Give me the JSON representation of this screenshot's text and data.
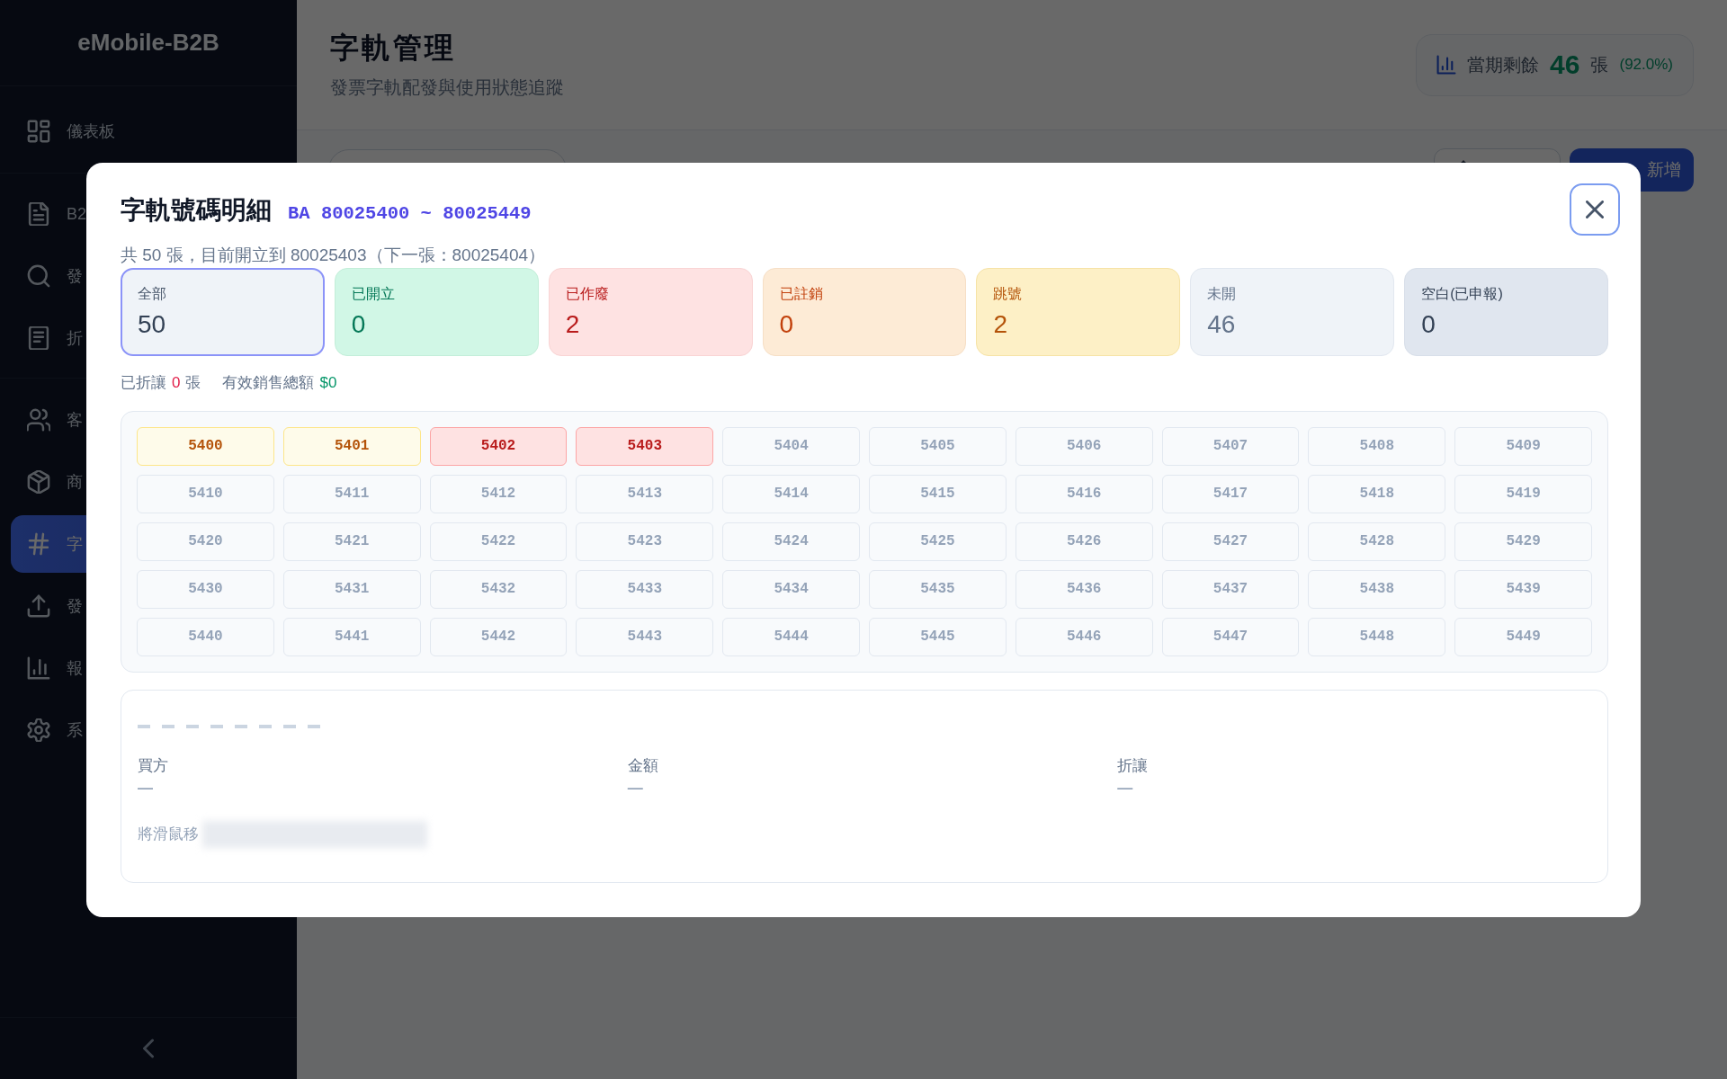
{
  "sidebar": {
    "brand": "eMobile-B2B",
    "sections": [
      {
        "items": [
          {
            "label": "儀表板",
            "selected": false
          }
        ]
      },
      {
        "items": [
          {
            "label": "B2",
            "selected": false
          },
          {
            "label": "發",
            "selected": false
          },
          {
            "label": "折",
            "selected": false
          }
        ]
      },
      {
        "items": [
          {
            "label": "客",
            "selected": false
          },
          {
            "label": "商",
            "selected": false
          },
          {
            "label": "字",
            "selected": true
          },
          {
            "label": "發",
            "selected": false
          },
          {
            "label": "報",
            "selected": false
          },
          {
            "label": "系",
            "selected": false
          }
        ]
      }
    ]
  },
  "page_header": {
    "title": "字軌管理",
    "subtitle": "發票字軌配發與使用狀態追蹤",
    "remaining": {
      "label": "當期剩餘",
      "count": "46",
      "unit": "張",
      "percent": "(92.0%)"
    }
  },
  "toolbar": {
    "add_button": "新增"
  },
  "modal": {
    "title": "字軌號碼明細",
    "range": "BA 80025400 ~ 80025449",
    "close_button": {
      "focused": true
    },
    "summary": "共 50 張，目前開立到 80025403（下一張：80025404）",
    "stats": [
      {
        "label": "全部",
        "value": "50",
        "kind": "all",
        "selected": true
      },
      {
        "label": "已開立",
        "value": "0",
        "kind": "issued",
        "selected": false
      },
      {
        "label": "已作廢",
        "value": "2",
        "kind": "void",
        "selected": false
      },
      {
        "label": "已註銷",
        "value": "0",
        "kind": "cancelled",
        "selected": false
      },
      {
        "label": "跳號",
        "value": "2",
        "kind": "skipped",
        "selected": false
      },
      {
        "label": "未開",
        "value": "46",
        "kind": "unused",
        "selected": false
      },
      {
        "label": "空白(已申報)",
        "value": "0",
        "kind": "blank",
        "selected": false
      }
    ],
    "totals": [
      {
        "label": "已折讓",
        "value": "0",
        "unit": "張",
        "color": "#e11d48"
      },
      {
        "label": "有效銷售總額",
        "value": "$0",
        "color": "#059669"
      }
    ],
    "numbers": [
      {
        "number": "5400",
        "kind": "skipped"
      },
      {
        "number": "5401",
        "kind": "skipped"
      },
      {
        "number": "5402",
        "kind": "void"
      },
      {
        "number": "5403",
        "kind": "void"
      },
      {
        "number": "5404",
        "kind": "unused"
      },
      {
        "number": "5405",
        "kind": "unused"
      },
      {
        "number": "5406",
        "kind": "unused"
      },
      {
        "number": "5407",
        "kind": "unused"
      },
      {
        "number": "5408",
        "kind": "unused"
      },
      {
        "number": "5409",
        "kind": "unused"
      },
      {
        "number": "5410",
        "kind": "unused"
      },
      {
        "number": "5411",
        "kind": "unused"
      },
      {
        "number": "5412",
        "kind": "unused"
      },
      {
        "number": "5413",
        "kind": "unused"
      },
      {
        "number": "5414",
        "kind": "unused"
      },
      {
        "number": "5415",
        "kind": "unused"
      },
      {
        "number": "5416",
        "kind": "unused"
      },
      {
        "number": "5417",
        "kind": "unused"
      },
      {
        "number": "5418",
        "kind": "unused"
      },
      {
        "number": "5419",
        "kind": "unused"
      },
      {
        "number": "5420",
        "kind": "unused"
      },
      {
        "number": "5421",
        "kind": "unused"
      },
      {
        "number": "5422",
        "kind": "unused"
      },
      {
        "number": "5423",
        "kind": "unused"
      },
      {
        "number": "5424",
        "kind": "unused"
      },
      {
        "number": "5425",
        "kind": "unused"
      },
      {
        "number": "5426",
        "kind": "unused"
      },
      {
        "number": "5427",
        "kind": "unused"
      },
      {
        "number": "5428",
        "kind": "unused"
      },
      {
        "number": "5429",
        "kind": "unused"
      },
      {
        "number": "5430",
        "kind": "unused"
      },
      {
        "number": "5431",
        "kind": "unused"
      },
      {
        "number": "5432",
        "kind": "unused"
      },
      {
        "number": "5433",
        "kind": "unused"
      },
      {
        "number": "5434",
        "kind": "unused"
      },
      {
        "number": "5435",
        "kind": "unused"
      },
      {
        "number": "5436",
        "kind": "unused"
      },
      {
        "number": "5437",
        "kind": "unused"
      },
      {
        "number": "5438",
        "kind": "unused"
      },
      {
        "number": "5439",
        "kind": "unused"
      },
      {
        "number": "5440",
        "kind": "unused"
      },
      {
        "number": "5441",
        "kind": "unused"
      },
      {
        "number": "5442",
        "kind": "unused"
      },
      {
        "number": "5443",
        "kind": "unused"
      },
      {
        "number": "5444",
        "kind": "unused"
      },
      {
        "number": "5445",
        "kind": "unused"
      },
      {
        "number": "5446",
        "kind": "unused"
      },
      {
        "number": "5447",
        "kind": "unused"
      },
      {
        "number": "5448",
        "kind": "unused"
      },
      {
        "number": "5449",
        "kind": "unused"
      }
    ],
    "detail": {
      "fields": [
        {
          "label": "買方",
          "value": "—"
        },
        {
          "label": "金額",
          "value": "—"
        },
        {
          "label": "折讓",
          "value": "—"
        }
      ],
      "hint": "將滑鼠移"
    }
  }
}
